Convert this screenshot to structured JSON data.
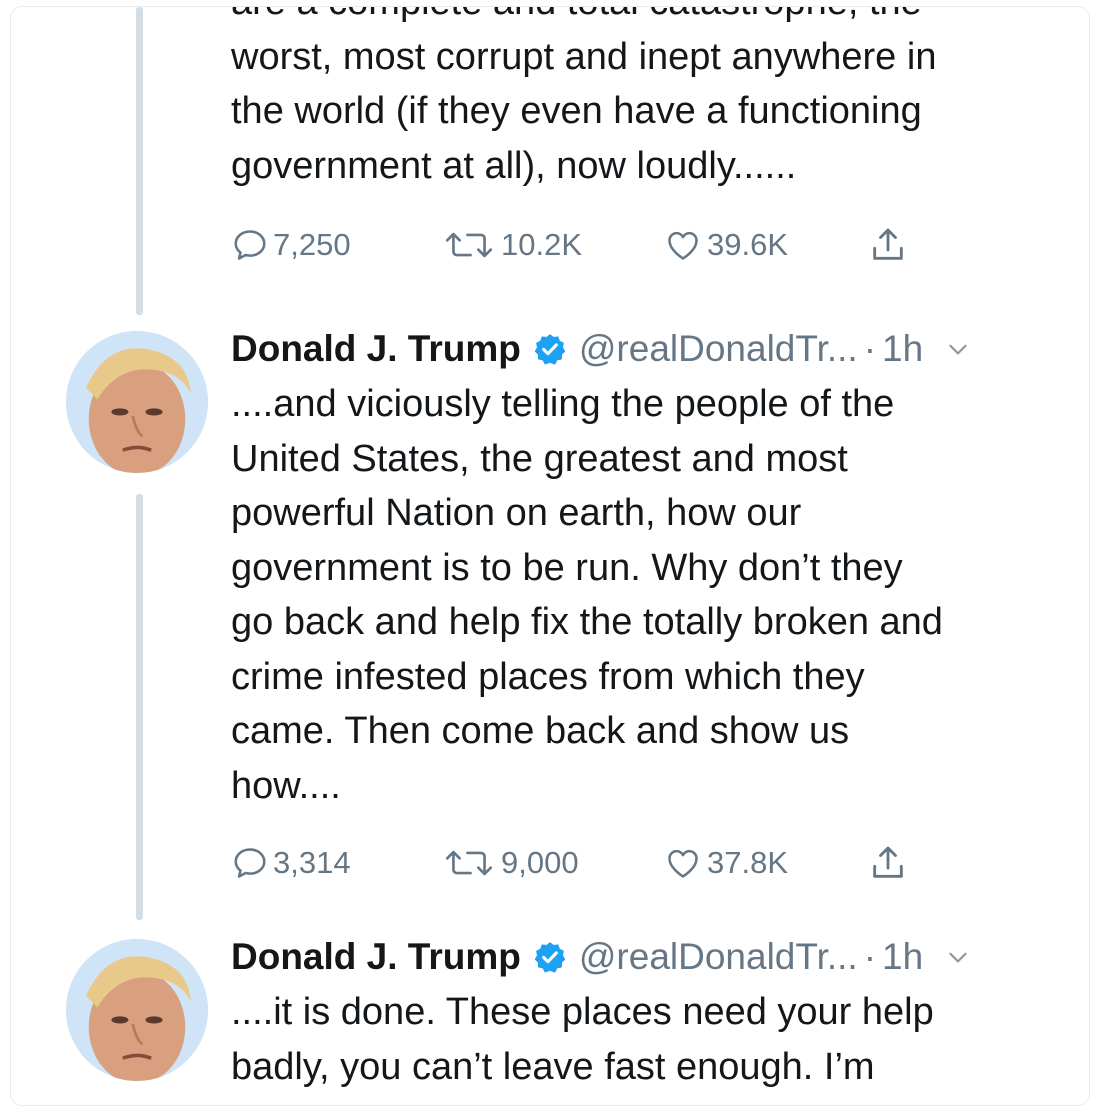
{
  "tweets": [
    {
      "text_lines": [
        "are a complete and total catastrophe, the",
        "worst, most corrupt and inept anywhere in",
        "the world (if they even have a functioning",
        "government at all), now loudly......"
      ],
      "replies": "7,250",
      "retweets": "10.2K",
      "likes": "39.6K"
    },
    {
      "author_name": "Donald J. Trump",
      "handle": "@realDonaldTr...",
      "separator": "·",
      "time": "1h",
      "text_lines": [
        "....and viciously telling the people of the",
        "United States, the greatest and most",
        "powerful Nation on earth, how our",
        "government is to be run. Why don’t they",
        "go back and help fix the totally broken and",
        "crime infested places from which they",
        "came. Then come back and show us",
        "how...."
      ],
      "replies": "3,314",
      "retweets": "9,000",
      "likes": "37.8K"
    },
    {
      "author_name": "Donald J. Trump",
      "handle": "@realDonaldTr...",
      "separator": "·",
      "time": "1h",
      "text_lines": [
        "....it is done. These places need your help",
        "badly, you can’t leave fast enough. I’m"
      ]
    }
  ],
  "colors": {
    "text": "#14171a",
    "muted": "#657786",
    "verified": "#1da1f2",
    "thread_line": "#d4dde3"
  },
  "icons": [
    "reply-icon",
    "retweet-icon",
    "like-icon",
    "share-icon",
    "verified-badge-icon",
    "chevron-down-icon"
  ]
}
